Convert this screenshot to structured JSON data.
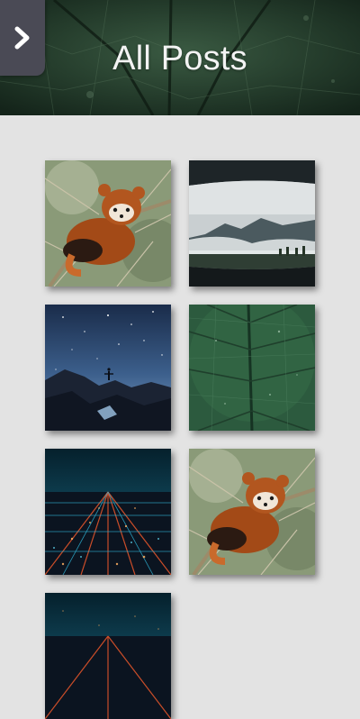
{
  "header": {
    "title": "All Posts",
    "menu_toggle_icon": "chevron-right-icon"
  },
  "posts": [
    {
      "subject": "red-panda-on-branch"
    },
    {
      "subject": "mountain-view-through-car-mirror"
    },
    {
      "subject": "person-on-rocks-under-starry-sky"
    },
    {
      "subject": "green-leaf-closeup"
    },
    {
      "subject": "city-lights-at-night"
    },
    {
      "subject": "red-panda-on-branch"
    },
    {
      "subject": "city-lights-at-night"
    }
  ],
  "colors": {
    "page_background": "#e3e3e3",
    "header_overlay": "#1e3325",
    "menu_button": "#4a4a55",
    "title_text": "#f3f3f3"
  }
}
